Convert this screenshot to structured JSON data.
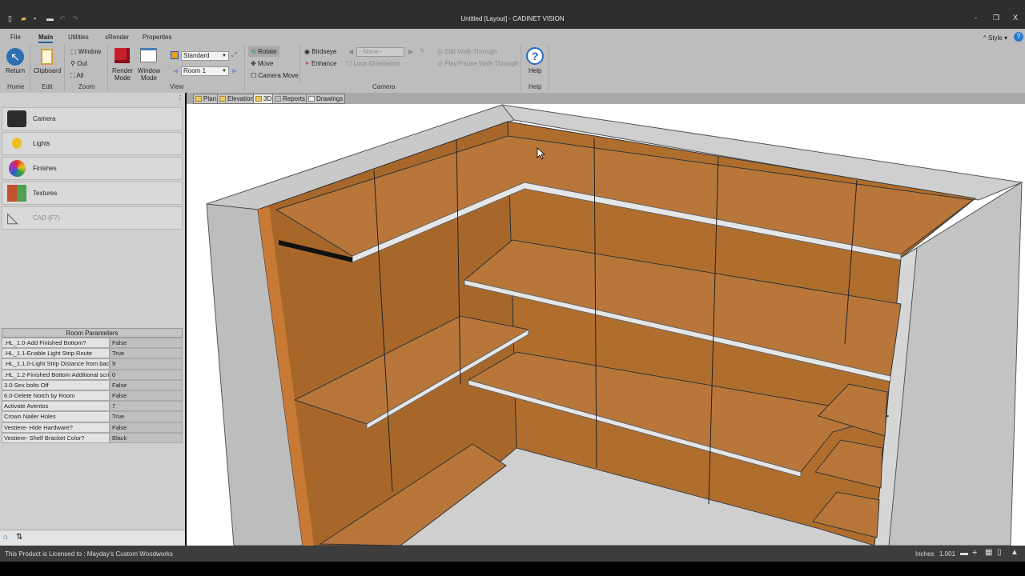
{
  "window": {
    "title": "Untitled [Layout] - CADINET VISION",
    "minimize": "-",
    "restore": "❐",
    "close": "X"
  },
  "quick_access": [
    "new-icon",
    "open-icon",
    "save-icon",
    "print-icon",
    "undo-icon",
    "redo-icon"
  ],
  "ribbon": {
    "tabs": [
      {
        "label": "File"
      },
      {
        "label": "Main",
        "active": true
      },
      {
        "label": "Utilities"
      },
      {
        "label": "xRender"
      },
      {
        "label": "Properties"
      }
    ],
    "style_label": "Style",
    "home": {
      "return": "Return",
      "group": "Home"
    },
    "edit": {
      "clipboard": "Clipboard",
      "group": "Edit"
    },
    "zoom": {
      "window": "Window",
      "out": "Out",
      "all": "All",
      "group": "Zoom"
    },
    "view": {
      "render_mode": "Render Mode",
      "window_mode": "Window Mode",
      "style_select": "Standard",
      "room_select": "Room 1",
      "group": "View"
    },
    "camera": {
      "rotate": "Rotate",
      "move": "Move",
      "camera_move": "Camera Move",
      "birdseye": "Birdseye",
      "enhance": "Enhance",
      "camera_select": "--None--",
      "lock_orientation": "Lock Orientation",
      "edit_walk": "Edit Walk Through",
      "play_walk": "Play/Pause Walk Through",
      "group": "Camera"
    },
    "help": {
      "help": "Help",
      "group": "Help"
    }
  },
  "view_tabs": [
    {
      "label": "Plan"
    },
    {
      "label": "Elevation"
    },
    {
      "label": "3D",
      "active": true
    },
    {
      "label": "Reports"
    },
    {
      "label": "Drawings"
    }
  ],
  "left_panel": {
    "items": [
      {
        "label": "Camera"
      },
      {
        "label": "Lights"
      },
      {
        "label": "Finishes"
      },
      {
        "label": "Textures"
      },
      {
        "label": "CAD (F7)",
        "disabled": true
      }
    ],
    "params_title": "Room Parameters",
    "params": [
      {
        "k": ".HL_1.0-Add Finished Bottom?",
        "v": "False"
      },
      {
        "k": ".HL_1.1-Enable Light Strip Route",
        "v": "True"
      },
      {
        "k": ".HL_1.1.0-Light Strip Distance from back",
        "v": "9"
      },
      {
        "k": ".HL_1.2-Finished Bottom Additional scribe",
        "v": "0"
      },
      {
        "k": "3.0-Sex bolts Off",
        "v": "False"
      },
      {
        "k": "6.0-Delete Notch by Room",
        "v": "False"
      },
      {
        "k": "Activate Aventos",
        "v": "7"
      },
      {
        "k": "Crown Nailer Holes",
        "v": "True"
      },
      {
        "k": "Vestiere- Hide Hardware?",
        "v": "False"
      },
      {
        "k": "Vestiere- Shelf Bracket Color?",
        "v": "Black"
      }
    ]
  },
  "status": {
    "license": "This Product is Licensed to : Mayday's Custom Woodworks",
    "units": "Inches",
    "scale": "1.001"
  },
  "colors": {
    "wood": "#b06e2e",
    "wall": "#c8c8c8",
    "accent": "#1f5f9f"
  }
}
